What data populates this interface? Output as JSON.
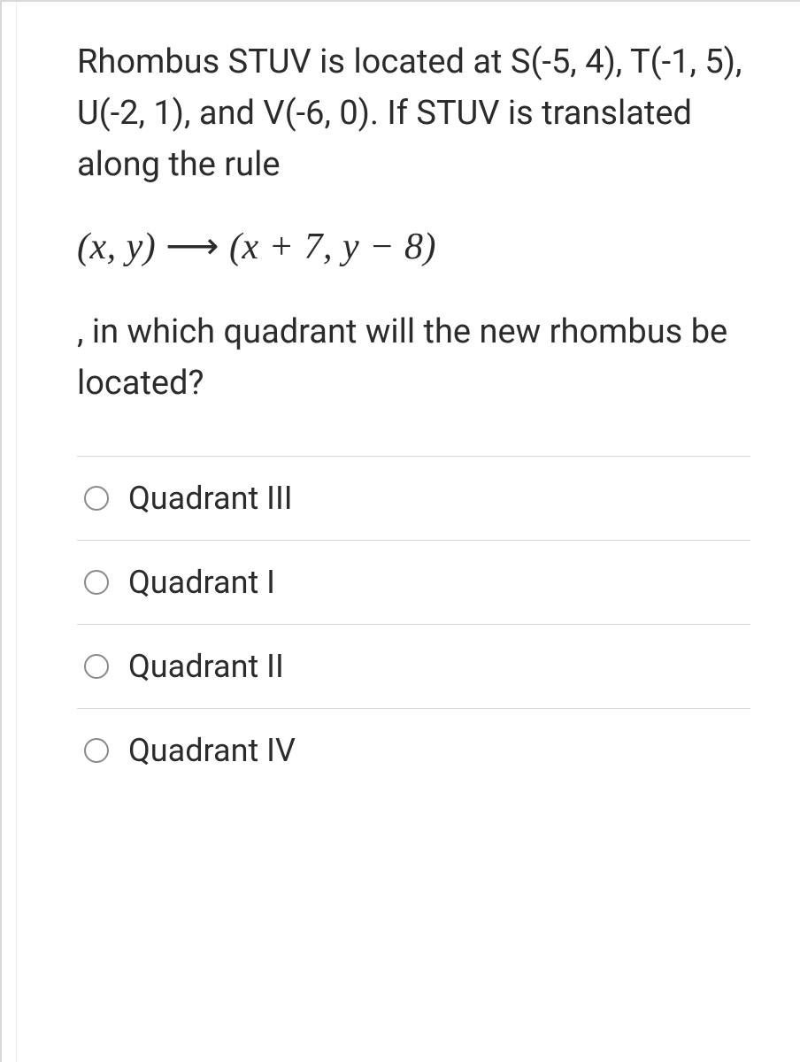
{
  "question": {
    "line1": "Rhombus STUV is located at S(-5, 4), T(-1, 5), U(-2, 1), and V(-6, 0).  If STUV is translated along the rule",
    "formula_left": "(x, y)",
    "formula_arrow": "⟶",
    "formula_right": "(x + 7, y − 8)",
    "line2": ", in which quadrant will the new rhombus be located?"
  },
  "options": [
    {
      "label": "Quadrant III"
    },
    {
      "label": "Quadrant I"
    },
    {
      "label": "Quadrant II"
    },
    {
      "label": "Quadrant IV"
    }
  ]
}
